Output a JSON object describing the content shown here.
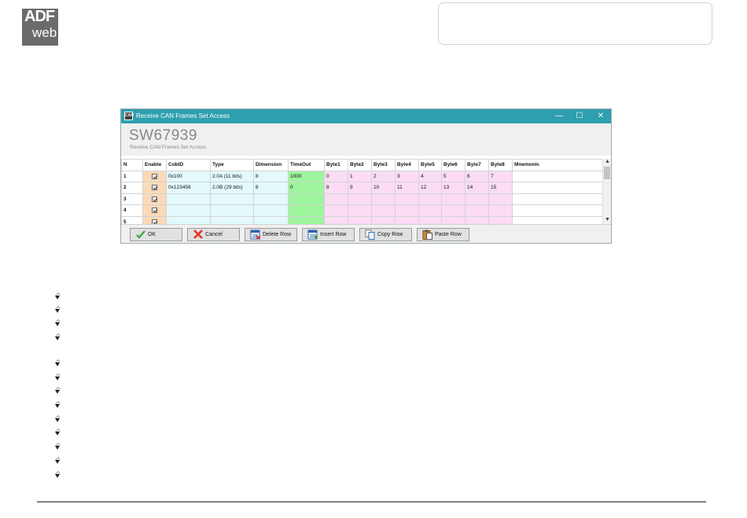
{
  "logo": {
    "line1": "ADF",
    "line2": "web"
  },
  "window": {
    "title": "Receive CAN Frames Set Access",
    "app_icon_text": "CAN",
    "controls": {
      "minimize": "—",
      "maximize": "☐",
      "close": "✕"
    }
  },
  "header": {
    "title": "SW67939",
    "subtitle": "Receive CAN Frames Set Access"
  },
  "table": {
    "columns": [
      "N",
      "Enable",
      "CobID",
      "Type",
      "Dimension",
      "TimeOut",
      "Byte1",
      "Byte2",
      "Byte3",
      "Byte4",
      "Byte5",
      "Byte6",
      "Byte7",
      "Byte8",
      "Mnemonic"
    ],
    "rows": [
      {
        "n": "1",
        "cobid": "0x100",
        "type": "2.0A (11 bits)",
        "dimension": "8",
        "timeout": "1000",
        "bytes": [
          "0",
          "1",
          "2",
          "3",
          "4",
          "5",
          "6",
          "7"
        ],
        "mnemonic": ""
      },
      {
        "n": "2",
        "cobid": "0x123456",
        "type": "2.0B (29 bits)",
        "dimension": "8",
        "timeout": "0",
        "bytes": [
          "8",
          "9",
          "10",
          "11",
          "12",
          "13",
          "14",
          "15"
        ],
        "mnemonic": ""
      },
      {
        "n": "3",
        "cobid": "",
        "type": "",
        "dimension": "",
        "timeout": "",
        "bytes": [
          "",
          "",
          "",
          "",
          "",
          "",
          "",
          ""
        ],
        "mnemonic": ""
      },
      {
        "n": "4",
        "cobid": "",
        "type": "",
        "dimension": "",
        "timeout": "",
        "bytes": [
          "",
          "",
          "",
          "",
          "",
          "",
          "",
          ""
        ],
        "mnemonic": ""
      },
      {
        "n": "5",
        "cobid": "",
        "type": "",
        "dimension": "",
        "timeout": "",
        "bytes": [
          "",
          "",
          "",
          "",
          "",
          "",
          "",
          ""
        ],
        "mnemonic": ""
      }
    ]
  },
  "buttons": {
    "ok": "OK",
    "cancel": "Cancel",
    "delete_row": "Delete Row",
    "insert_row": "Insert Row",
    "copy_row": "Copy Row",
    "paste_row": "Paste Row"
  },
  "colors": {
    "titlebar": "#2e9faf",
    "enable_col": "#fbd9b8",
    "cobid_type_dim": "#e3f9fc",
    "timeout_col": "#9ef59e",
    "byte_cols": "#fbdcf4"
  }
}
